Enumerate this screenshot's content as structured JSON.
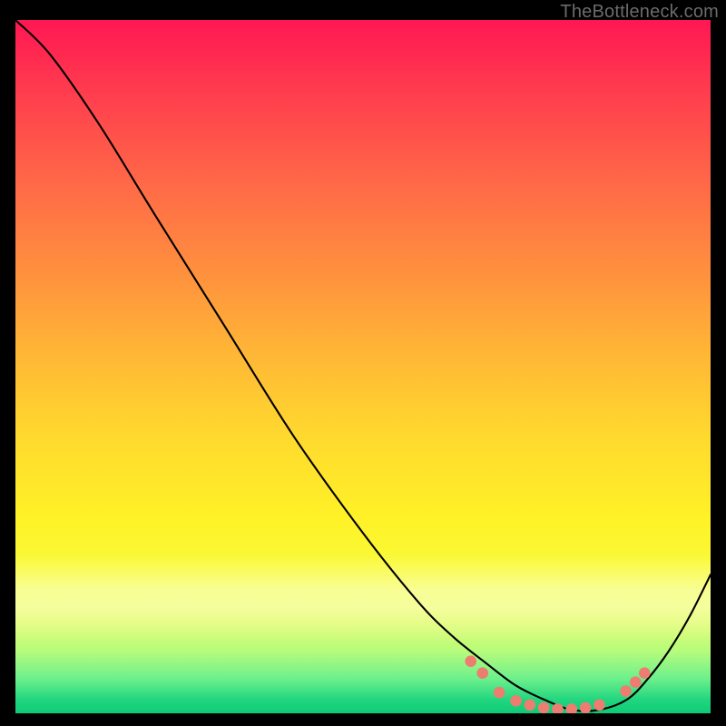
{
  "watermark": "TheBottleneck.com",
  "chart_data": {
    "type": "line",
    "title": "",
    "xlabel": "",
    "ylabel": "",
    "xlim": [
      0,
      1
    ],
    "ylim": [
      0,
      1
    ],
    "note": "Axes are unlabeled; values are normalized 0–1. Curve depicts a steep decline to a near-zero trough around x≈0.80 then a rise; red dot markers cluster near the trough.",
    "series": [
      {
        "name": "curve",
        "x": [
          0.0,
          0.05,
          0.12,
          0.2,
          0.3,
          0.4,
          0.5,
          0.58,
          0.63,
          0.68,
          0.72,
          0.76,
          0.8,
          0.84,
          0.88,
          0.91,
          0.94,
          0.97,
          1.0
        ],
        "y": [
          1.0,
          0.95,
          0.85,
          0.72,
          0.56,
          0.4,
          0.26,
          0.16,
          0.11,
          0.07,
          0.04,
          0.02,
          0.005,
          0.005,
          0.02,
          0.05,
          0.09,
          0.14,
          0.2
        ]
      }
    ],
    "markers": {
      "name": "dots",
      "color": "#ee7d71",
      "points": [
        {
          "x": 0.655,
          "y": 0.075
        },
        {
          "x": 0.672,
          "y": 0.058
        },
        {
          "x": 0.696,
          "y": 0.03
        },
        {
          "x": 0.72,
          "y": 0.018
        },
        {
          "x": 0.74,
          "y": 0.012
        },
        {
          "x": 0.76,
          "y": 0.008
        },
        {
          "x": 0.78,
          "y": 0.006
        },
        {
          "x": 0.8,
          "y": 0.006
        },
        {
          "x": 0.82,
          "y": 0.008
        },
        {
          "x": 0.84,
          "y": 0.012
        },
        {
          "x": 0.878,
          "y": 0.032
        },
        {
          "x": 0.892,
          "y": 0.045
        },
        {
          "x": 0.905,
          "y": 0.058
        }
      ]
    },
    "gradient_stops": [
      {
        "pos": 0.0,
        "color": "#ff1753"
      },
      {
        "pos": 0.5,
        "color": "#ffd22e"
      },
      {
        "pos": 0.8,
        "color": "#fff84a"
      },
      {
        "pos": 1.0,
        "color": "#0ecb77"
      }
    ]
  }
}
